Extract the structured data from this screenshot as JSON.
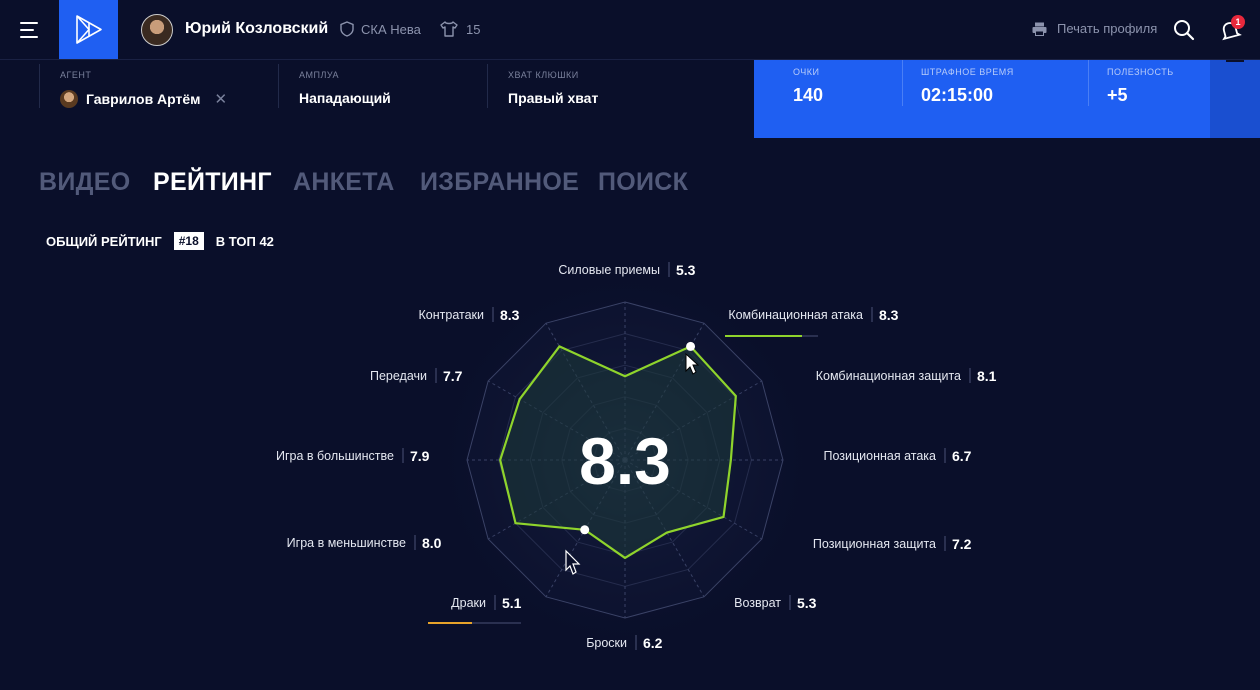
{
  "header": {
    "player_name": "Юрий Козловский",
    "team": "СКА Нева",
    "number": "15",
    "print_label": "Печать профиля",
    "notifications_count": "1"
  },
  "info": {
    "agent_label": "АГЕНТ",
    "agent_value": "Гаврилов Артём",
    "role_label": "АМПЛУА",
    "role_value": "Нападающий",
    "grip_label": "ХВАТ КЛЮШКИ",
    "grip_value": "Правый хват"
  },
  "stats": {
    "points_label": "ОЧКИ",
    "points_value": "140",
    "penalty_label": "ШТРАФНОЕ ВРЕМЯ",
    "penalty_value": "02:15:00",
    "plusminus_label": "ПОЛЕЗНОСТЬ",
    "plusminus_value": "+5"
  },
  "tabs": [
    "ВИДЕО",
    "РЕЙТИНГ",
    "АНКЕТА",
    "ИЗБРАННОЕ",
    "ПОИСК"
  ],
  "active_tab": "РЕЙТИНГ",
  "overall": {
    "label": "ОБЩИЙ РЕЙТИНГ",
    "rank": "#18",
    "top": "В ТОП 42"
  },
  "colors": {
    "background": "#0a0f2a",
    "accent": "#1f5ff2",
    "radar_line": "#8fd42c",
    "highlight_orange": "#e8a32a"
  },
  "chart_data": {
    "type": "radar",
    "center_value": "8.3",
    "scale_max": 10,
    "axes": [
      {
        "label": "Силовые приемы",
        "value": 5.3
      },
      {
        "label": "Комбинационная атака",
        "value": 8.3
      },
      {
        "label": "Комбинационная защита",
        "value": 8.1
      },
      {
        "label": "Позиционная атака",
        "value": 6.7
      },
      {
        "label": "Позиционная защита",
        "value": 7.2
      },
      {
        "label": "Возврат",
        "value": 5.3
      },
      {
        "label": "Броски",
        "value": 6.2
      },
      {
        "label": "Драки",
        "value": 5.1
      },
      {
        "label": "Игра в меньшинстве",
        "value": 8.0
      },
      {
        "label": "Игра в большинстве",
        "value": 7.9
      },
      {
        "label": "Передачи",
        "value": 7.7
      },
      {
        "label": "Контратаки",
        "value": 8.3
      }
    ]
  }
}
